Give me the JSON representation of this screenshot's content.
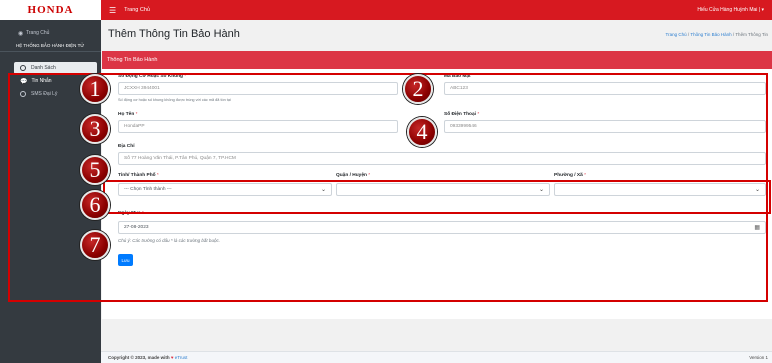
{
  "header": {
    "logo": "HONDA",
    "menu_icon": "hamburger-icon",
    "home_label": "Trang Chủ",
    "user_label": "Hiếu Cửa Hàng Huỳnh Mai | ▾"
  },
  "sidebar": {
    "home_label": "Trang Chủ",
    "group_label": "HỆ THỐNG BẢO HÀNH ĐIỆN TỬ",
    "items": [
      {
        "label": "Danh Sách",
        "active": true
      },
      {
        "label": "Tin Nhắn",
        "active": false
      },
      {
        "label": "SMS Đại Lý",
        "active": false
      }
    ]
  },
  "page": {
    "title": "Thêm Thông Tin Bảo Hành",
    "breadcrumb": [
      "Trang Chủ",
      "Thông Tin Bảo Hành",
      "Thêm Thông Tin"
    ],
    "breadcrumb_sep": "/"
  },
  "form": {
    "header": "Thông Tin Bảo Hành",
    "engine_label": "Số Động Cơ Hoặc Số Khung",
    "engine_placeholder": "JCXXH 3944001",
    "engine_help": "Số động cơ hoặc số khung không được trùng với các mã đã tồn tại",
    "secret_label": "Mã Bảo Mật",
    "secret_placeholder": "ABC123",
    "name_label": "Họ Tên",
    "name_placeholder": "HondaPP",
    "phone_label": "Số Điện Thoại",
    "phone_placeholder": "0933999546",
    "address_label": "Địa Chỉ",
    "address_placeholder": "Số 77 Hoàng Văn Thái, P.Tân Phú, Quận 7, TP.HCM",
    "province_label": "Tỉnh/ Thành Phố",
    "province_value": "--- Chọn Tỉnh thành ---",
    "district_label": "Quận / Huyện",
    "district_value": "",
    "ward_label": "Phường / Xã",
    "ward_value": "",
    "date_label": "Ngày Mua",
    "date_value": "27-08-2023",
    "required_mark": "*",
    "note": "Chú ý: Các trường có dấu * là các trường bắt buộc.",
    "save_label": "Lưu"
  },
  "footer": {
    "copyright": "Copyright © 2023, made with",
    "heart": "♥",
    "brand": "eTrust",
    "version": "Version 1"
  },
  "annotations": [
    "1",
    "2",
    "3",
    "4",
    "5",
    "6",
    "7"
  ],
  "colors": {
    "brand_red": "#d71920",
    "card_header_red": "#dc3545",
    "sidebar_bg": "#343a40",
    "primary_blue": "#007bff",
    "annotation_red": "#d40000"
  }
}
